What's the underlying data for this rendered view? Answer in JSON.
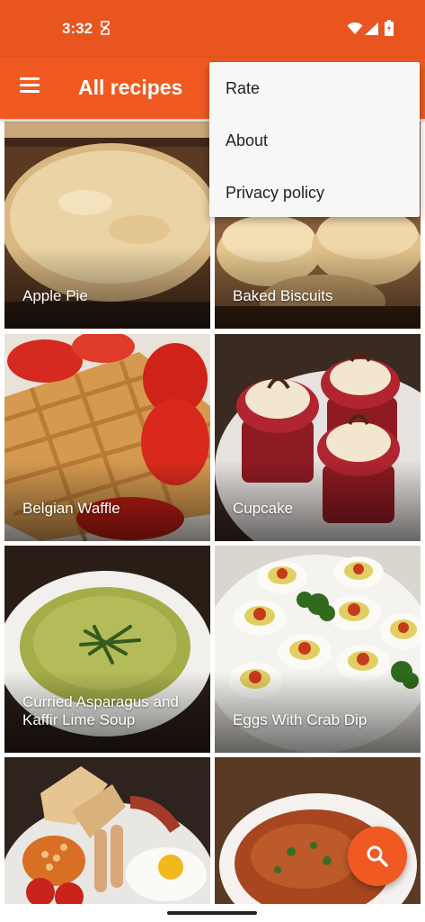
{
  "status_bar": {
    "time": "3:32"
  },
  "app_bar": {
    "title": "All recipes"
  },
  "overflow_menu": {
    "items": [
      "Rate",
      "About",
      "Privacy policy"
    ]
  },
  "recipes": [
    {
      "name": "Apple Pie"
    },
    {
      "name": "Baked Biscuits"
    },
    {
      "name": "Belgian Waffle"
    },
    {
      "name": "Cupcake"
    },
    {
      "name": "Curried Asparagus and Kaffir Lime Soup"
    },
    {
      "name": "Eggs With Crab Dip"
    },
    {
      "name": ""
    },
    {
      "name": ""
    }
  ],
  "icons": {
    "menu": "hamburger-menu-icon",
    "search": "search-icon",
    "wifi": "wifi-icon",
    "signal": "cell-signal-icon",
    "battery": "battery-icon",
    "notification": "notification-icon"
  },
  "colors": {
    "accent": "#f05a22",
    "status_bar": "#e8551f",
    "menu_background": "#f7f7f7"
  }
}
